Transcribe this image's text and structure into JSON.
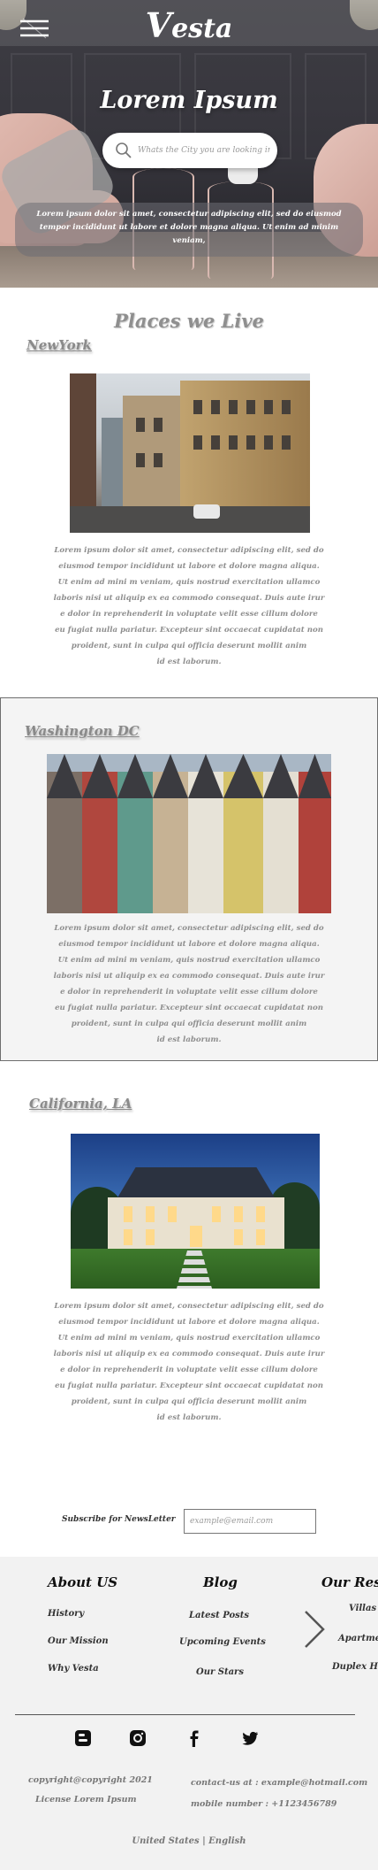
{
  "header": {
    "brand_initial": "V",
    "brand_rest": "esta",
    "menu_icon": "hamburger-icon"
  },
  "hero": {
    "title": "Lorem Ipsum",
    "search_placeholder": "Whats the City you are looking in ?",
    "search_icon": "search-icon",
    "text": "Lorem ipsum dolor sit amet, consectetur adipiscing elit, sed do eiusmod tempor incididunt ut labore et dolore magna aliqua. Ut enim ad minim veniam,"
  },
  "places": {
    "heading": "Places we Live",
    "items": [
      {
        "name": "NewYork",
        "lines": [
          "Lorem ipsum dolor sit amet, consectetur adipiscing elit, sed do",
          "eiusmod tempor incididunt ut labore et dolore magna aliqua.",
          "Ut enim ad mini m veniam, quis nostrud exercitation ullamco",
          "laboris nisi ut aliquip ex ea  commodo consequat. Duis aute irur",
          "e dolor in reprehenderit in voluptate velit esse cillum dolore",
          "eu fugiat nulla pariatur. Excepteur sint occaecat  cupidatat non",
          "proident, sunt in culpa qui officia deserunt mollit anim",
          "id est laborum."
        ]
      },
      {
        "name": "Washington DC",
        "lines": [
          "Lorem ipsum dolor sit amet, consectetur adipiscing elit, sed do",
          "eiusmod tempor incididunt ut labore et dolore magna aliqua.",
          "Ut enim ad mini m veniam, quis nostrud exercitation ullamco",
          "laboris nisi ut aliquip ex ea  commodo consequat. Duis aute irur",
          "e dolor in reprehenderit in voluptate velit esse cillum dolore",
          "eu fugiat nulla pariatur. Excepteur sint occaecat  cupidatat non",
          "proident, sunt in culpa qui officia deserunt mollit anim",
          "id est laborum."
        ]
      },
      {
        "name": "California, LA",
        "lines": [
          "Lorem ipsum dolor sit amet, consectetur adipiscing elit, sed do",
          "eiusmod tempor incididunt ut labore et dolore magna aliqua.",
          "Ut enim ad mini m veniam, quis nostrud exercitation ullamco",
          "laboris nisi ut aliquip ex ea  commodo consequat. Duis aute irur",
          "e dolor in reprehenderit in voluptate velit esse cillum dolore",
          "eu fugiat nulla pariatur. Excepteur sint occaecat  cupidatat non",
          "proident, sunt in culpa qui officia deserunt mollit anim",
          "id est laborum."
        ]
      }
    ]
  },
  "subscribe": {
    "label": "Subscribe for NewsLetter",
    "placeholder": "example@email.com"
  },
  "footer": {
    "about": {
      "title": "About US",
      "links": [
        "History",
        "Our Mission",
        "Why Vesta"
      ]
    },
    "blog": {
      "title": "Blog",
      "links": [
        "Latest Posts",
        "Upcoming Events",
        "Our Stars"
      ]
    },
    "residences": {
      "title": "Our Resic",
      "links": [
        "Villas",
        "Apartme",
        "Duplex Ho"
      ]
    },
    "next_icon": "chevron-right-icon",
    "social_icons": [
      "blogger-icon",
      "instagram-icon",
      "facebook-icon",
      "twitter-icon"
    ],
    "copyright": "copyright@copyright 2021",
    "license": "License Lorem Ipsum",
    "contact": "contact-us at : example@hotmail.com",
    "mobile": "mobile number : +1123456789",
    "locale": "United States | English"
  },
  "colors": {
    "hero_overlay": "#3e3d44",
    "place_name": "#8a8a8a",
    "body_text": "#8e8e8e",
    "footer_bg": "#f2f2f2",
    "place_box_bg": "#f4f4f4"
  }
}
